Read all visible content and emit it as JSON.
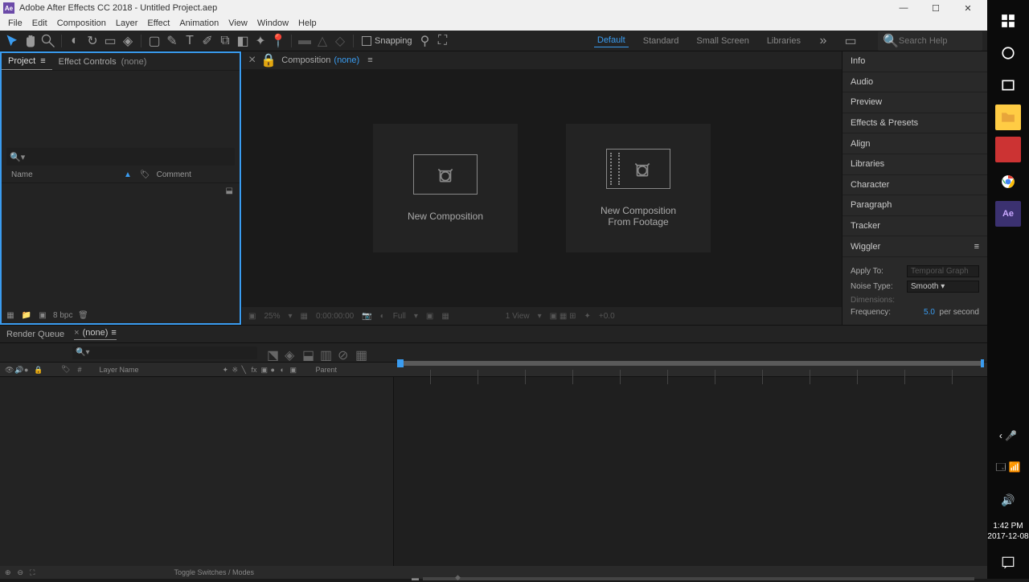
{
  "titlebar": {
    "app": "Adobe After Effects CC 2018 - Untitled Project.aep"
  },
  "menubar": [
    "File",
    "Edit",
    "Composition",
    "Layer",
    "Effect",
    "Animation",
    "View",
    "Window",
    "Help"
  ],
  "toolbar": {
    "snapping": "Snapping"
  },
  "workspaces": {
    "items": [
      "Default",
      "Standard",
      "Small Screen",
      "Libraries"
    ],
    "active": 0,
    "search_placeholder": "Search Help"
  },
  "project": {
    "tab_project": "Project",
    "tab_effect_controls": "Effect Controls",
    "tab_effect_none": "(none)",
    "col_name": "Name",
    "col_comment": "Comment",
    "bpc": "8 bpc"
  },
  "comp": {
    "tab": "Composition",
    "tab_none": "(none)",
    "new_comp": "New Composition",
    "new_comp_footage_l1": "New Composition",
    "new_comp_footage_l2": "From Footage",
    "footer_zoom": "25%",
    "footer_time": "0:00:00:00",
    "footer_res": "Full",
    "footer_view": "1 View",
    "footer_exp": "+0.0"
  },
  "right_panels": [
    "Info",
    "Audio",
    "Preview",
    "Effects & Presets",
    "Align",
    "Libraries",
    "Character",
    "Paragraph",
    "Tracker"
  ],
  "wiggler": {
    "title": "Wiggler",
    "apply_to": "Apply To:",
    "apply_to_val": "Temporal Graph",
    "noise_type": "Noise Type:",
    "noise_type_val": "Smooth",
    "dimensions": "Dimensions:",
    "frequency": "Frequency:",
    "frequency_val": "5.0",
    "frequency_unit": "per second"
  },
  "timeline": {
    "render_queue": "Render Queue",
    "none_tab": "(none)",
    "col_num": "#",
    "col_layer": "Layer Name",
    "col_parent": "Parent",
    "footer_toggle": "Toggle Switches / Modes"
  },
  "taskbar": {
    "time": "1:42 PM",
    "date": "2017-12-08"
  }
}
